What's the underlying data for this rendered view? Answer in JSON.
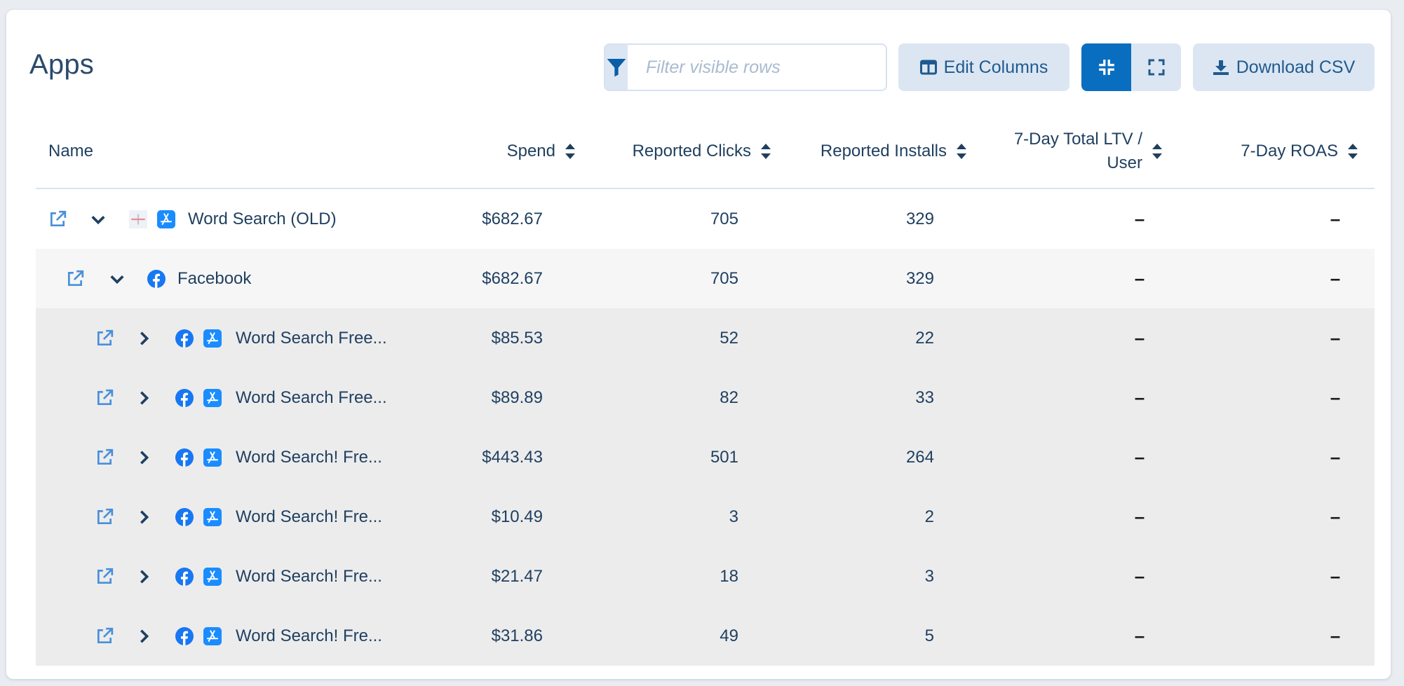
{
  "page": {
    "title": "Apps"
  },
  "toolbar": {
    "filter_placeholder": "Filter visible rows",
    "edit_columns_label": "Edit Columns",
    "download_csv_label": "Download CSV"
  },
  "table": {
    "columns": {
      "name": "Name",
      "spend": "Spend",
      "clicks": "Reported Clicks",
      "installs": "Reported Installs",
      "ltv_line1": "7-Day Total LTV /",
      "ltv_line2": "User",
      "roas": "7-Day ROAS"
    },
    "rows": [
      {
        "level": 0,
        "expander": "chevron-down",
        "icons": [
          "placeholder-icon",
          "app-store-icon"
        ],
        "name": "Word Search (OLD)",
        "spend": "$682.67",
        "clicks": "705",
        "installs": "329",
        "ltv": "–",
        "roas": "–"
      },
      {
        "level": 1,
        "expander": "chevron-down",
        "icons": [
          "facebook-icon"
        ],
        "name": "Facebook",
        "spend": "$682.67",
        "clicks": "705",
        "installs": "329",
        "ltv": "–",
        "roas": "–"
      },
      {
        "level": 2,
        "expander": "chevron-right",
        "icons": [
          "facebook-icon",
          "app-store-icon"
        ],
        "name": "Word Search Free...",
        "spend": "$85.53",
        "clicks": "52",
        "installs": "22",
        "ltv": "–",
        "roas": "–"
      },
      {
        "level": 2,
        "expander": "chevron-right",
        "icons": [
          "facebook-icon",
          "app-store-icon"
        ],
        "name": "Word Search Free...",
        "spend": "$89.89",
        "clicks": "82",
        "installs": "33",
        "ltv": "–",
        "roas": "–"
      },
      {
        "level": 2,
        "expander": "chevron-right",
        "icons": [
          "facebook-icon",
          "app-store-icon"
        ],
        "name": "Word Search! Fre...",
        "spend": "$443.43",
        "clicks": "501",
        "installs": "264",
        "ltv": "–",
        "roas": "–"
      },
      {
        "level": 2,
        "expander": "chevron-right",
        "icons": [
          "facebook-icon",
          "app-store-icon"
        ],
        "name": "Word Search! Fre...",
        "spend": "$10.49",
        "clicks": "3",
        "installs": "2",
        "ltv": "–",
        "roas": "–"
      },
      {
        "level": 2,
        "expander": "chevron-right",
        "icons": [
          "facebook-icon",
          "app-store-icon"
        ],
        "name": "Word Search! Fre...",
        "spend": "$21.47",
        "clicks": "18",
        "installs": "3",
        "ltv": "–",
        "roas": "–"
      },
      {
        "level": 2,
        "expander": "chevron-right",
        "icons": [
          "facebook-icon",
          "app-store-icon"
        ],
        "name": "Word Search! Fre...",
        "spend": "$31.86",
        "clicks": "49",
        "installs": "5",
        "ltv": "–",
        "roas": "–"
      }
    ]
  },
  "colors": {
    "accent": "#0a6ec0",
    "button_bg": "#dbe6f2",
    "text": "#1f3f5f",
    "link_icon": "#4a90d9",
    "facebook": "#1877f2",
    "app_store": "#1a8cff"
  }
}
